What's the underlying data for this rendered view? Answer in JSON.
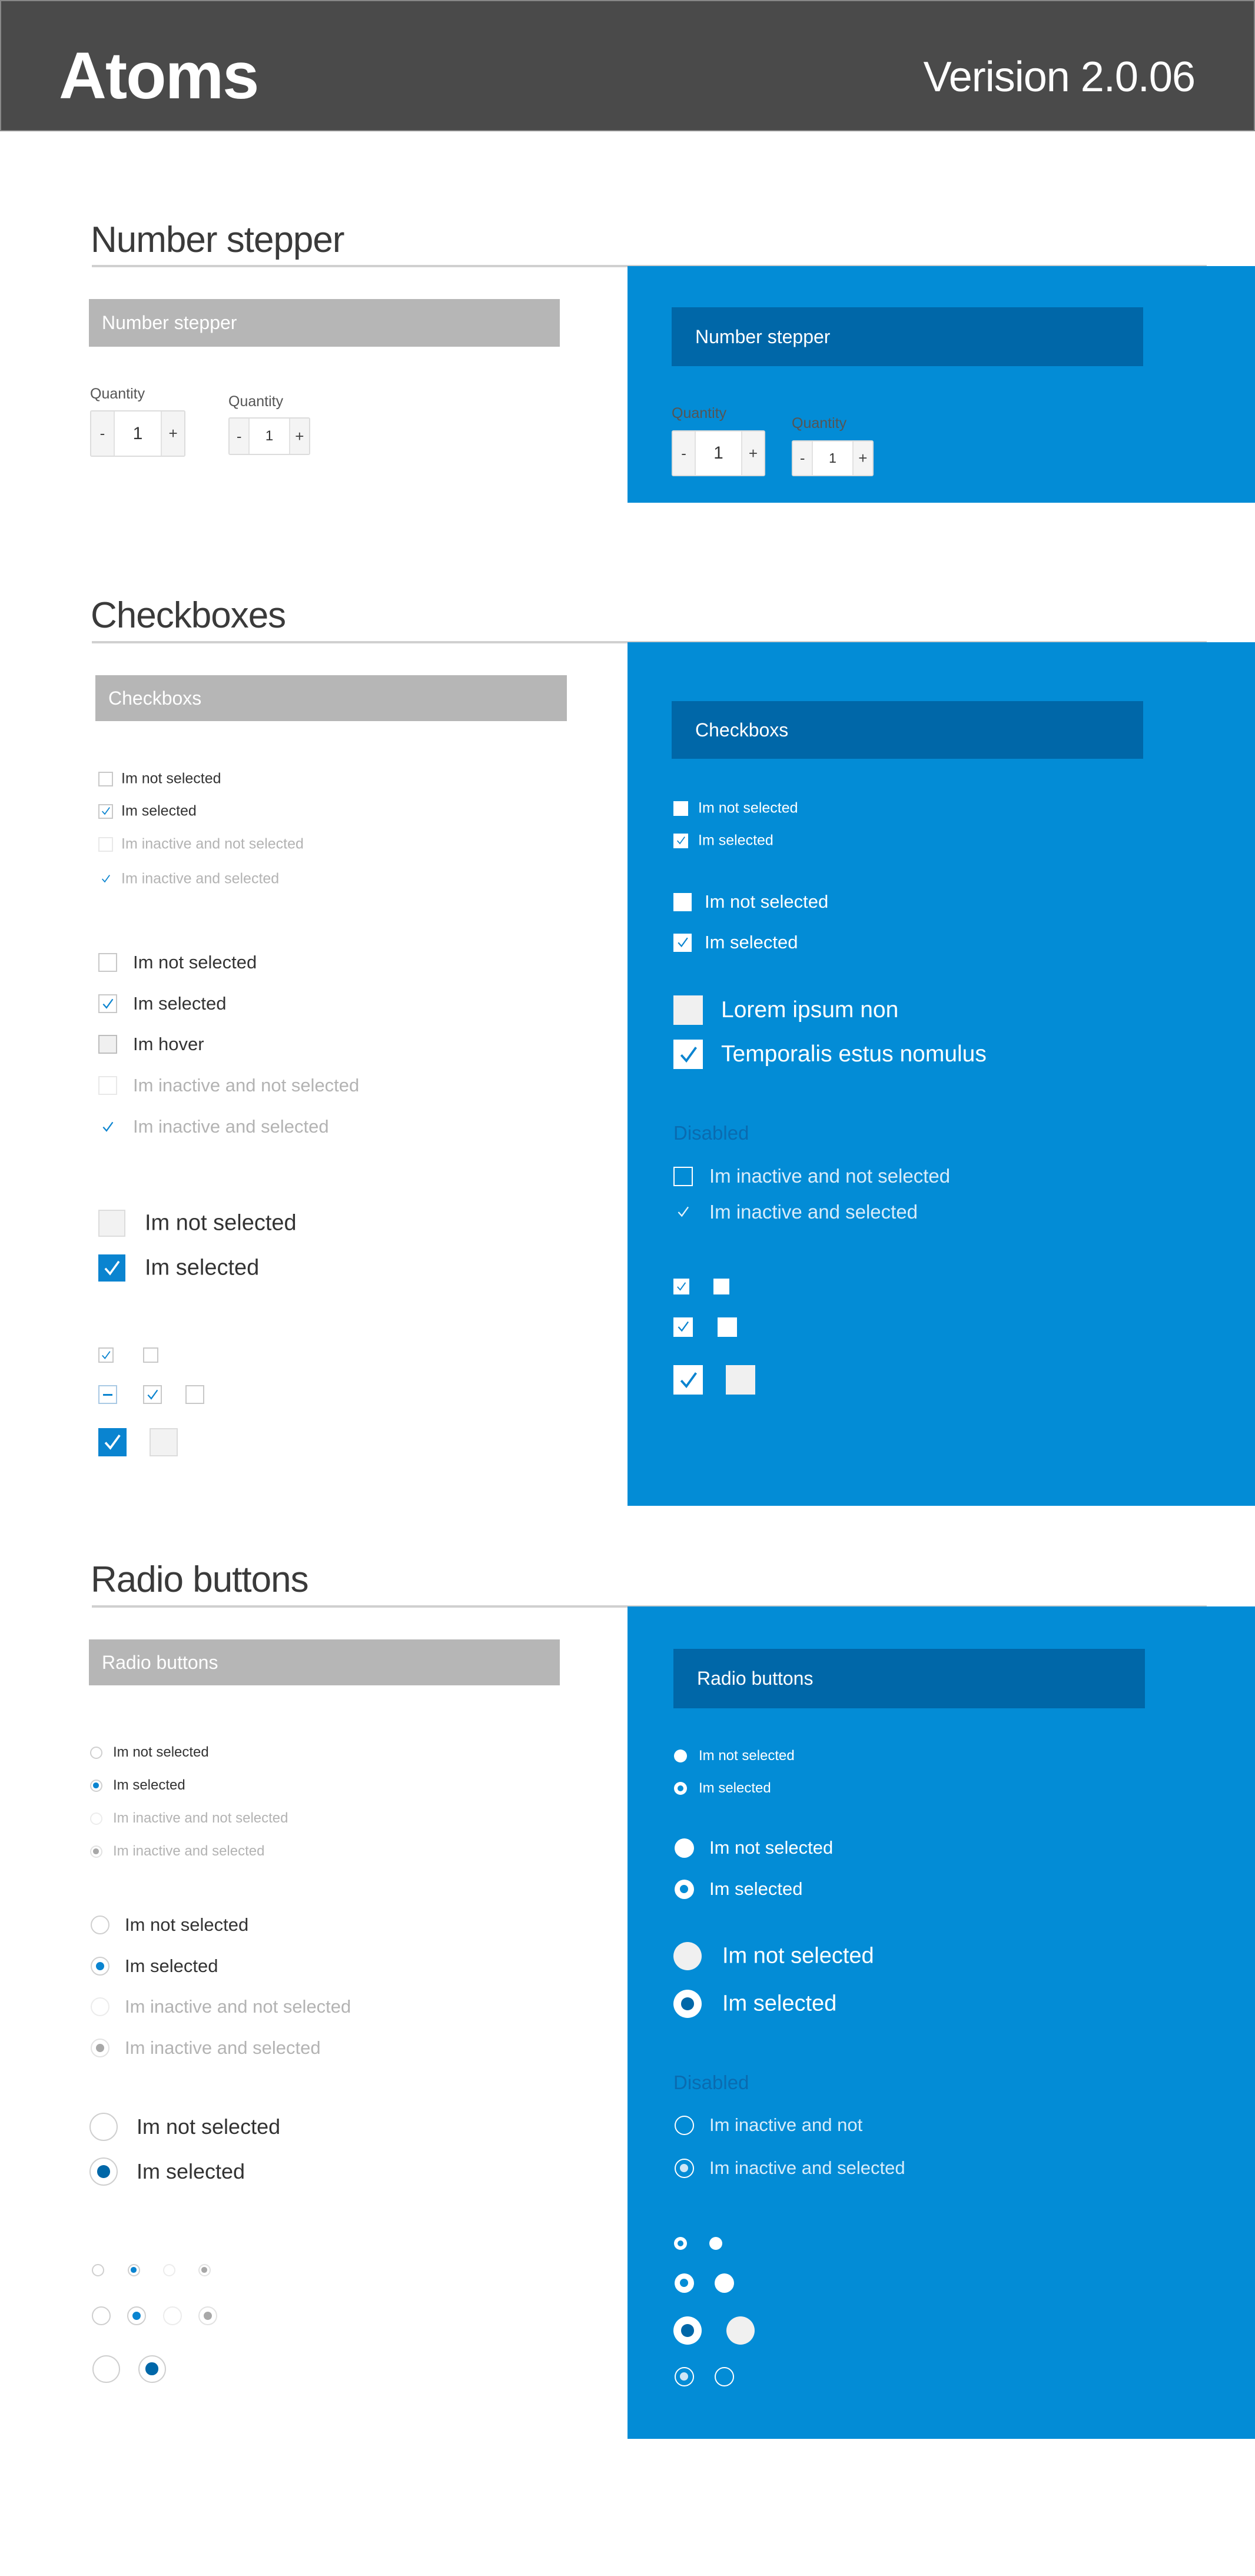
{
  "header": {
    "title": "Atoms",
    "version": "Verision 2.0.06"
  },
  "colors": {
    "header": "#4a4a4a",
    "panel_blue": "#038cd6",
    "bar_dark_blue": "#0067a8",
    "bar_gray": "#b6b6b6",
    "accent": "#0a84d0"
  },
  "stepper": {
    "title": "Number stepper",
    "card_label_light": "Number stepper",
    "card_label_dark": "Number stepper",
    "minus": "-",
    "plus": "+",
    "light": [
      {
        "label": "Quantity",
        "value": "1"
      },
      {
        "label": "Quantity",
        "value": "1"
      }
    ],
    "dark": [
      {
        "label": "Quantity",
        "value": "1"
      },
      {
        "label": "Quantity",
        "value": "1"
      }
    ]
  },
  "checkboxes": {
    "title": "Checkboxes",
    "card_label_light": "Checkboxs",
    "card_label_dark": "Checkboxs",
    "disabled_label": "Disabled",
    "light": {
      "small": [
        {
          "label": "Im not selected",
          "state": "unchecked"
        },
        {
          "label": "Im selected",
          "state": "checked"
        },
        {
          "label": "Im inactive and not selected",
          "state": "disabled"
        },
        {
          "label": "Im inactive and selected",
          "state": "disabled-checked"
        }
      ],
      "medium": [
        {
          "label": "Im not selected",
          "state": "unchecked"
        },
        {
          "label": "Im selected",
          "state": "checked"
        },
        {
          "label": "Im hover",
          "state": "hover"
        },
        {
          "label": "Im inactive and not selected",
          "state": "disabled"
        },
        {
          "label": "Im inactive and selected",
          "state": "disabled-checked"
        }
      ],
      "large": [
        {
          "label": "Im not selected",
          "state": "unchecked"
        },
        {
          "label": "Im selected",
          "state": "checked"
        }
      ],
      "mini": [
        [
          "checked",
          "unchecked"
        ],
        [
          "indeterminate",
          "checked",
          "unchecked"
        ],
        [
          "checked",
          "unchecked"
        ]
      ]
    },
    "dark": {
      "small": [
        {
          "label": "Im not selected",
          "state": "unchecked"
        },
        {
          "label": "Im selected",
          "state": "checked"
        }
      ],
      "medium": [
        {
          "label": "Im not selected",
          "state": "unchecked"
        },
        {
          "label": "Im selected",
          "state": "checked"
        }
      ],
      "large": [
        {
          "label": "Lorem ipsum non",
          "state": "unchecked"
        },
        {
          "label": "Temporalis estus nomulus",
          "state": "checked"
        }
      ],
      "disabled": [
        {
          "label": "Im inactive and not selected",
          "state": "disabled"
        },
        {
          "label": "Im inactive and selected",
          "state": "disabled-checked"
        }
      ],
      "mini": [
        [
          "checked",
          "unchecked"
        ],
        [
          "checked",
          "unchecked"
        ],
        [
          "checked",
          "unchecked"
        ]
      ]
    }
  },
  "radios": {
    "title": "Radio buttons",
    "card_label_light": "Radio buttons",
    "card_label_dark": "Radio buttons",
    "disabled_label": "Disabled",
    "light": {
      "small": [
        {
          "label": "Im not selected",
          "state": "unchecked"
        },
        {
          "label": "Im selected",
          "state": "checked"
        },
        {
          "label": "Im inactive and not selected",
          "state": "disabled"
        },
        {
          "label": "Im inactive and selected",
          "state": "disabled-checked"
        }
      ],
      "medium": [
        {
          "label": "Im not selected",
          "state": "unchecked"
        },
        {
          "label": "Im selected",
          "state": "checked"
        },
        {
          "label": "Im inactive and not selected",
          "state": "disabled"
        },
        {
          "label": "Im inactive and selected",
          "state": "disabled-checked"
        }
      ],
      "large": [
        {
          "label": "Im not selected",
          "state": "unchecked"
        },
        {
          "label": "Im selected",
          "state": "checked"
        }
      ],
      "mini": [
        [
          "unchecked",
          "checked",
          "disabled",
          "disabled-checked"
        ],
        [
          "unchecked",
          "checked",
          "disabled",
          "disabled-checked"
        ],
        [
          "unchecked",
          "checked"
        ]
      ]
    },
    "dark": {
      "small": [
        {
          "label": "Im not selected",
          "state": "unchecked"
        },
        {
          "label": "Im selected",
          "state": "checked"
        }
      ],
      "medium": [
        {
          "label": "Im not selected",
          "state": "unchecked"
        },
        {
          "label": "Im selected",
          "state": "checked"
        }
      ],
      "large": [
        {
          "label": "Im not  selected",
          "state": "unchecked"
        },
        {
          "label": "Im  selected",
          "state": "checked"
        }
      ],
      "disabled": [
        {
          "label": "Im inactive and not",
          "state": "disabled"
        },
        {
          "label": "Im inactive and selected",
          "state": "disabled-checked"
        }
      ],
      "mini": [
        [
          "checked",
          "unchecked"
        ],
        [
          "checked",
          "unchecked"
        ],
        [
          "checked",
          "unchecked"
        ],
        [
          "disabled-checked",
          "disabled"
        ]
      ]
    }
  }
}
